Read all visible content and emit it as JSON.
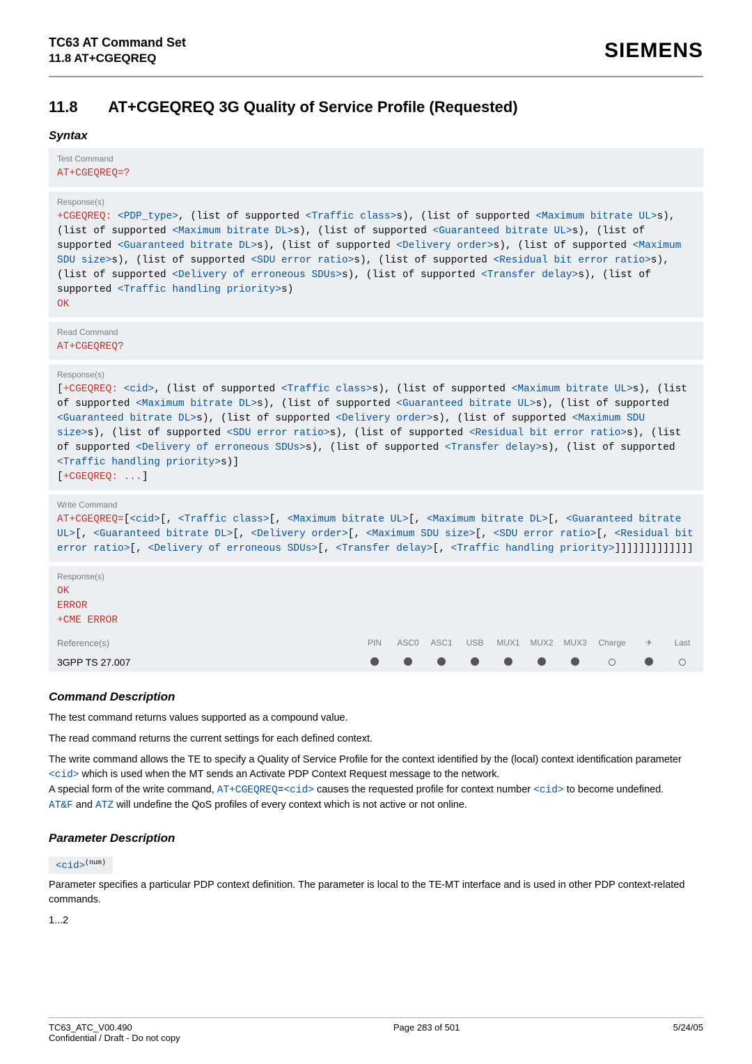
{
  "header": {
    "title": "TC63 AT Command Set",
    "subtitle": "11.8 AT+CGEQREQ",
    "brand": "SIEMENS"
  },
  "section": {
    "number": "11.8",
    "title": "AT+CGEQREQ   3G Quality of Service Profile (Requested)"
  },
  "syntax_label": "Syntax",
  "boxes": {
    "test_cmd_label": "Test Command",
    "test_cmd": "AT+CGEQREQ=?",
    "responses_label": "Response(s)",
    "read_cmd_label": "Read Command",
    "read_cmd": "AT+CGEQREQ?",
    "write_cmd_label": "Write Command",
    "ok": "OK",
    "error": "ERROR",
    "cme": "+CME ERROR",
    "ref_label": "Reference(s)",
    "ref_value": "3GPP TS 27.007",
    "cols": {
      "pin": "PIN",
      "asc0": "ASC0",
      "asc1": "ASC1",
      "usb": "USB",
      "mux1": "MUX1",
      "mux2": "MUX2",
      "mux3": "MUX3",
      "charge": "Charge",
      "air": "✈",
      "last": "Last"
    }
  },
  "test_response": {
    "prefix": "+CGEQREQ: ",
    "pdp_type": "<PDP_type>",
    "t1": ", (list of supported ",
    "traffic_class": "<Traffic class>",
    "t2": "s), (list of supported ",
    "max_br_ul": "<Maximum bitrate UL>",
    "t3": "s), (list of supported ",
    "max_br_dl": "<Maximum bitrate DL>",
    "t4": "s), (list of supported ",
    "g_br_ul": "<Guaranteed bitrate UL>",
    "t5": "s), (list of supported ",
    "g_br_dl": "<Guaranteed bitrate DL>",
    "t6": "s), (list of supported ",
    "del_order": "<Delivery order>",
    "t7": "s), (list of supported ",
    "max_sdu": "<Maximum SDU size>",
    "t8": "s), (list of supported ",
    "sdu_err": "<SDU error ratio>",
    "t9": "s), (list of supported ",
    "res_err": "<Residual bit error ratio>",
    "t10": "s), (list of supported ",
    "del_err": "<Delivery of erroneous SDUs>",
    "t11": "s), (list of supported ",
    "tr_delay": "<Transfer delay>",
    "t12": "s), (list of supported ",
    "tr_prio": "<Traffic handling priority>",
    "t13": "s)",
    "ok": "OK"
  },
  "read_response": {
    "open": "[",
    "prefix": "+CGEQREQ: ",
    "cid": "<cid>",
    "close_ellipsis": "+CGEQREQ: ...",
    "close_br": "]",
    "end_open": "[",
    "t_tail": "s)"
  },
  "write_cmd_line": {
    "cmd": "AT+CGEQREQ=",
    "ob": "[",
    "cid": "<cid>",
    "c1": "[, ",
    "traffic_class": "<Traffic class>",
    "max_br_ul": "<Maximum bitrate UL>",
    "max_br_dl": "<Maximum bitrate DL>",
    "g_br_ul": "<Guaranteed bitrate UL>",
    "g_br_dl": "<Guaranteed bitrate DL>",
    "del_order": "<Delivery order>",
    "max_sdu": "<Maximum SDU size>",
    "sdu_err": "<SDU error ratio>",
    "res_err": "<Residual bit error ratio>",
    "del_err": "<Delivery of erroneous SDUs>",
    "tr_delay": "<Transfer delay>",
    "tr_prio": "<Traffic handling priority>",
    "close": "]]]]]]]]]]]]]"
  },
  "cmd_desc_h": "Command Description",
  "cmd_desc": {
    "p1": "The test command returns values supported as a compound value.",
    "p2": "The read command returns the current settings for each defined context.",
    "p3a": "The write command allows the TE to specify a Quality of Service Profile for the context identified by the (local) context identification parameter ",
    "cid1": "<cid>",
    "p3b": " which is used when the MT sends an Activate PDP Context Request message to the network.",
    "p4a": "A special form of the write command, ",
    "atcmd": "AT+CGEQREQ",
    "eq": "=",
    "cid2": "<cid>",
    "p4b": " causes the requested profile for context number ",
    "cid3": "<cid>",
    "p4c": " to become undefined.",
    "p5a": "",
    "atf": "AT&F",
    "and": " and ",
    "atz": "ATZ",
    "p5b": " will undefine the QoS profiles of every context which is not active or not online."
  },
  "param_desc_h": "Parameter Description",
  "param": {
    "cid_label": "<cid>",
    "num": "(num)",
    "text": "Parameter specifies a particular PDP context definition. The parameter is local to the TE-MT interface and is used in other PDP context-related commands.",
    "range": "1...2"
  },
  "footer": {
    "left1": "TC63_ATC_V00.490",
    "left2": "Confidential / Draft - Do not copy",
    "center": "Page 283 of 501",
    "right": "5/24/05"
  }
}
